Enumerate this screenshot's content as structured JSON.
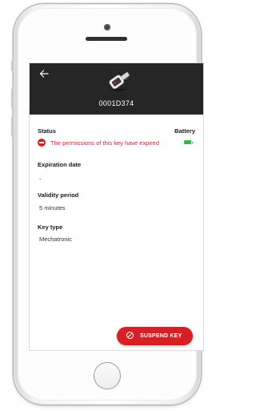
{
  "header": {
    "back_icon": "arrow-left-icon",
    "key_icon": "mechatronic-key-icon",
    "key_id": "0001D374"
  },
  "status": {
    "label": "Status",
    "icon": "no-entry-icon",
    "text": "The permissions of this key have expired",
    "color": "#d71f26"
  },
  "battery": {
    "label": "Battery",
    "icon": "battery-full-icon",
    "color": "#3bb54a"
  },
  "expiration": {
    "label": "Expiration date",
    "value": "-"
  },
  "validity": {
    "label": "Validity period",
    "value": "5 minutes"
  },
  "key_type": {
    "label": "Key type",
    "value": "Mechatronic"
  },
  "action": {
    "icon": "block-icon",
    "label": "SUSPEND KEY",
    "color": "#d71f26"
  },
  "header_color": "#262626"
}
